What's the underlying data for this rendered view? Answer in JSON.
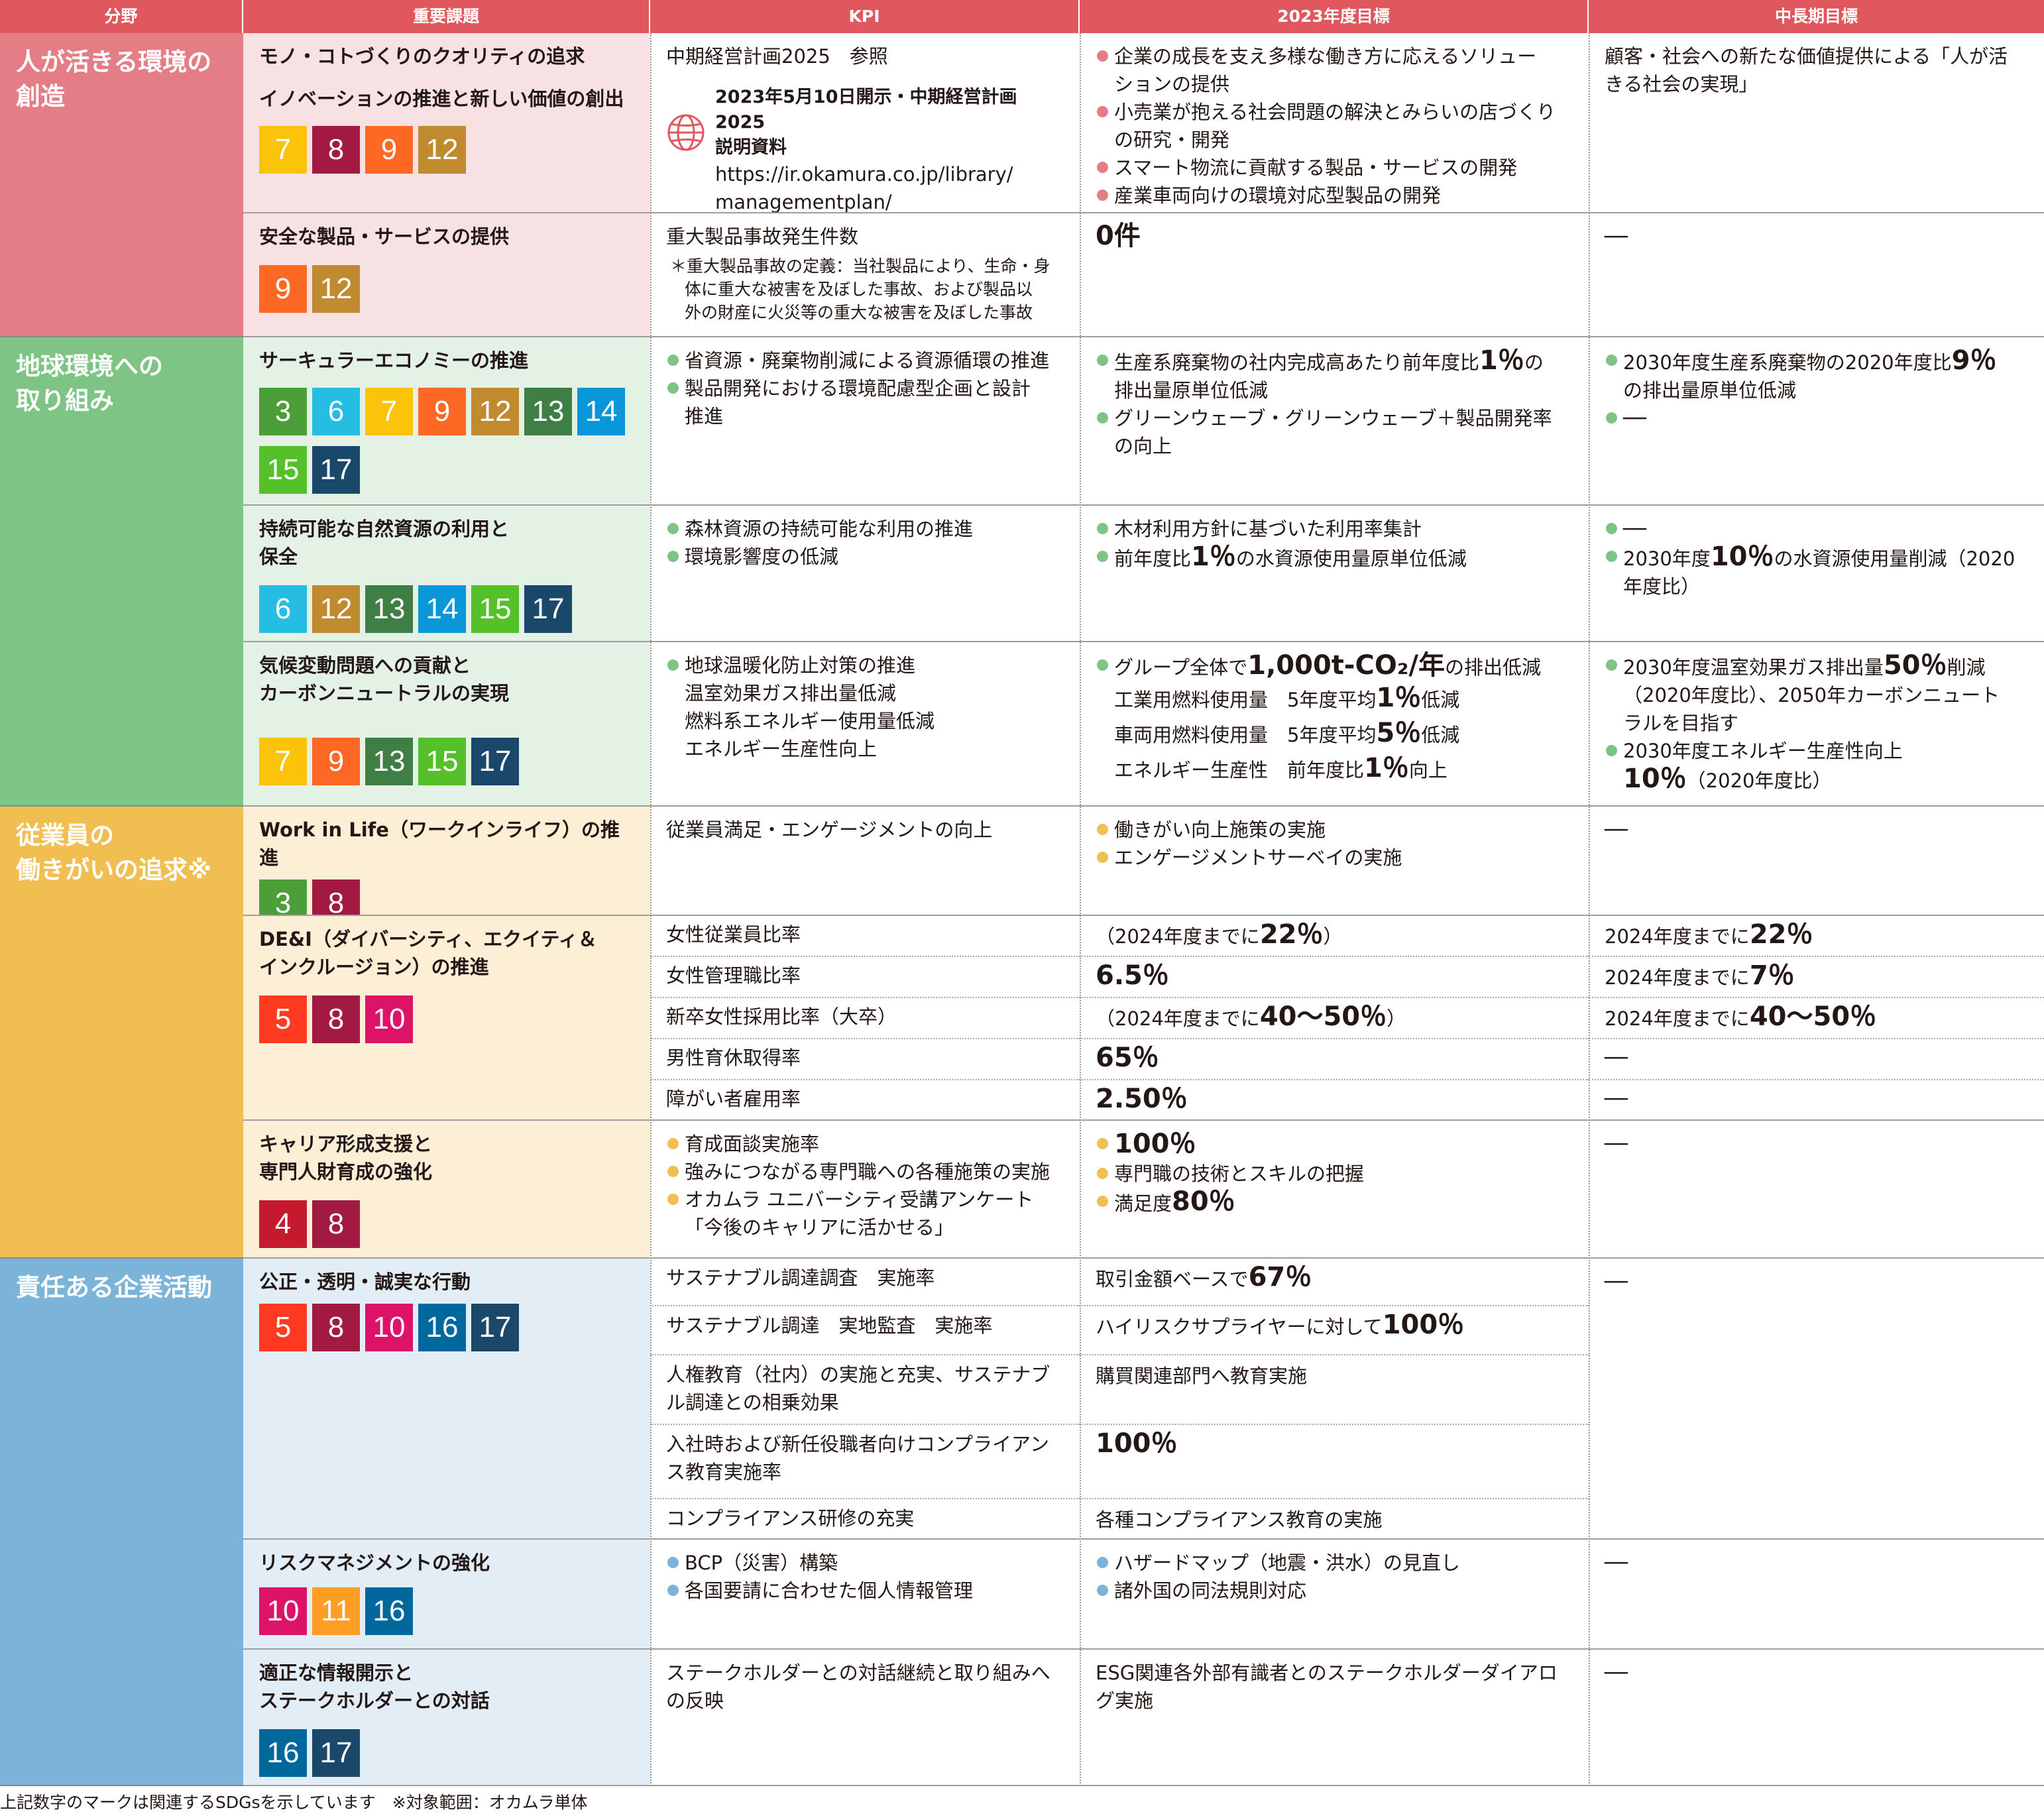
{
  "headers": [
    "分野",
    "重要課題",
    "KPI",
    "2023年度目標",
    "中長期目標"
  ],
  "colors": {
    "pink": "#e57d87",
    "pink_light": "#f7e1e3",
    "green": "#7dc485",
    "green_light": "#e4f2e6",
    "yellow": "#f1be52",
    "yellow_light": "#fcefd6",
    "blue": "#7bb4d8",
    "blue_light": "#e2edf6",
    "header": "#e0585d"
  },
  "sdg_colors": {
    "3": "#4c9f38",
    "4": "#c5192d",
    "5": "#ff3a21",
    "6": "#26bde2",
    "7": "#fcc30b",
    "8": "#a21942",
    "9": "#fd6925",
    "10": "#dd1367",
    "11": "#fd9d24",
    "12": "#bf8b2e",
    "13": "#3f7e44",
    "14": "#0a97d9",
    "15": "#56c02b",
    "16": "#00689d",
    "17": "#19486a"
  },
  "categories": [
    "人が活きる環境の\n創造",
    "地球環境への\n取り組み",
    "従業員の\n働きがいの追求※",
    "責任ある企業活動"
  ],
  "topics": {
    "t1": {
      "title": "モノ・コトづくりのクオリティの追求",
      "title2": "イノベーションの推進と新しい価値の創出",
      "sdgs": [
        "7",
        "8",
        "9",
        "12"
      ]
    },
    "t2": {
      "title": "安全な製品・サービスの提供",
      "sdgs": [
        "9",
        "12"
      ]
    },
    "t3": {
      "title": "サーキュラーエコノミーの推進",
      "sdgs": [
        "3",
        "6",
        "7",
        "9",
        "12",
        "13",
        "14",
        "15",
        "17"
      ]
    },
    "t4": {
      "title": "持続可能な自然資源の利用と\n保全",
      "sdgs": [
        "6",
        "12",
        "13",
        "14",
        "15",
        "17"
      ]
    },
    "t5": {
      "title": "気候変動問題への貢献と\nカーボンニュートラルの実現",
      "sdgs": [
        "7",
        "9",
        "13",
        "15",
        "17"
      ]
    },
    "t6": {
      "title": "Work in Life（ワークインライフ）の推進",
      "sdgs": [
        "3",
        "8"
      ]
    },
    "t7": {
      "title": "DE&I（ダイバーシティ、エクイティ＆\nインクルージョン）の推進",
      "sdgs": [
        "5",
        "8",
        "10"
      ]
    },
    "t8": {
      "title": "キャリア形成支援と\n専門人財育成の強化",
      "sdgs": [
        "4",
        "8"
      ]
    },
    "t9": {
      "title": "公正・透明・誠実な行動",
      "sdgs": [
        "5",
        "8",
        "10",
        "16",
        "17"
      ]
    },
    "t10": {
      "title": "リスクマネジメントの強化",
      "sdgs": [
        "10",
        "11",
        "16"
      ]
    },
    "t11": {
      "title": "適正な情報開示と\nステークホルダーとの対話",
      "sdgs": [
        "16",
        "17"
      ]
    }
  },
  "r1": {
    "kpi": "中期経営計画2025　参照",
    "link_title": "2023年5月10日開示・中期経営計画2025\n説明資料",
    "link_url": "https://ir.okamura.co.jp/library/\nmanagementplan/",
    "target": [
      "企業の成長を支え多様な働き方に応えるソリュー\nションの提供",
      "小売業が抱える社会問題の解決とみらいの店づくり\nの研究・開発",
      "スマート物流に貢献する製品・サービスの開発",
      "産業車両向けの環境対応型製品の開発"
    ],
    "long": "顧客・社会への新たな価値提供による「人が活\nきる社会の実現」"
  },
  "r2": {
    "kpi": "重大製品事故発生件数",
    "note": "＊重大製品事故の定義：当社製品により、生命・身\n体に重大な被害を及ぼした事故、および製品以\n外の財産に火災等の重大な被害を及ぼした事故",
    "target": "0件",
    "long": "──"
  },
  "r3": {
    "kpi": [
      "省資源・廃棄物削減による資源循環の推進",
      "製品開発における環境配慮型企画と設計\n推進"
    ],
    "target1_a": "生産系廃棄物の社内完成高あたり前年度比",
    "target1_b": "1％",
    "target1_c": "の\n排出量原単位低減",
    "target2": "グリーンウェーブ・グリーンウェーブ＋製品開発率\nの向上",
    "long1_a": "2030年度生産系廃棄物の2020年度比",
    "long1_b": "9％",
    "long1_c": "\nの排出量原単位低減",
    "long2": "──"
  },
  "r4": {
    "kpi": [
      "森林資源の持続可能な利用の推進",
      "環境影響度の低減"
    ],
    "target1": "木材利用方針に基づいた利用率集計",
    "target2_a": "前年度比",
    "target2_b": "1％",
    "target2_c": "の水資源使用量原単位低減",
    "long1": "──",
    "long2_a": "2030年度",
    "long2_b": "10％",
    "long2_c": "の水資源使用量削減（2020\n年度比）"
  },
  "r5": {
    "kpi": "地球温暖化防止対策の推進\n温室効果ガス排出量低減\n燃料系エネルギー使用量低減\nエネルギー生産性向上",
    "t_a": "グループ全体で",
    "t_b": "1,000t-CO₂/年",
    "t_c": "の排出低減",
    "t_l1": "工業用燃料使用量　5年度平均",
    "t_l1b": "1％",
    "t_l1c": "低減",
    "t_l2": "車両用燃料使用量　5年度平均",
    "t_l2b": "5％",
    "t_l2c": "低減",
    "t_l3": "エネルギー生産性　前年度比",
    "t_l3b": "1％",
    "t_l3c": "向上",
    "long1_a": "2030年度温室効果ガス排出量",
    "long1_b": "50％",
    "long1_c": "削減\n（2020年度比）、2050年カーボンニュート\nラルを目指す",
    "long2_a": "2030年度エネルギー生産性向上",
    "long2_b": "10％",
    "long2_c": "（2020年度比）"
  },
  "r6": {
    "kpi": "従業員満足・エンゲージメントの向上",
    "target": [
      "働きがい向上施策の実施",
      "エンゲージメントサーベイの実施"
    ],
    "long": "──"
  },
  "r7": {
    "rows": [
      {
        "kpi": "女性従業員比率",
        "t_a": "（2024年度までに",
        "t_b": "22％",
        "t_c": "）",
        "l_a": "2024年度までに",
        "l_b": "22％"
      },
      {
        "kpi": "女性管理職比率",
        "t_a": "",
        "t_b": "6.5％",
        "t_c": "",
        "l_a": "2024年度までに",
        "l_b": "7％"
      },
      {
        "kpi": "新卒女性採用比率（大卒）",
        "t_a": "（2024年度までに",
        "t_b": "40～50％",
        "t_c": "）",
        "l_a": "2024年度までに",
        "l_b": "40～50％"
      },
      {
        "kpi": "男性育休取得率",
        "t_a": "",
        "t_b": "65％",
        "t_c": "",
        "l_a": "",
        "l_b": "──"
      },
      {
        "kpi": "障がい者雇用率",
        "t_a": "",
        "t_b": "2.50％",
        "t_c": "",
        "l_a": "",
        "l_b": "──"
      }
    ]
  },
  "r8": {
    "kpi": [
      "育成面談実施率",
      "強みにつながる専門職への各種施策の実施",
      "オカムラ ユニバーシティ受講アンケート\n「今後のキャリアに活かせる」"
    ],
    "target1": "100％",
    "target2": "専門職の技術とスキルの把握",
    "target3_a": "満足度",
    "target3_b": "80％",
    "long": "──"
  },
  "r9": {
    "rows": [
      {
        "kpi": "サステナブル調達調査　実施率",
        "t_a": "取引金額ベースで",
        "t_b": "67％"
      },
      {
        "kpi": "サステナブル調達　実地監査　実施率",
        "t_a": "ハイリスクサプライヤーに対して",
        "t_b": "100％"
      },
      {
        "kpi": "人権教育（社内）の実施と充実、サステナブ\nル調達との相乗効果",
        "t_a": "購買関連部門へ教育実施",
        "t_b": ""
      },
      {
        "kpi": "入社時および新任役職者向けコンプライアン\nス教育実施率",
        "t_a": "",
        "t_b": "100％"
      },
      {
        "kpi": "コンプライアンス研修の充実",
        "t_a": "各種コンプライアンス教育の実施",
        "t_b": ""
      }
    ],
    "long": "──"
  },
  "r10": {
    "kpi": [
      "BCP（災害）構築",
      "各国要請に合わせた個人情報管理"
    ],
    "target": [
      "ハザードマップ（地震・洪水）の見直し",
      "諸外国の同法規則対応"
    ],
    "long": "──"
  },
  "r11": {
    "kpi": "ステークホルダーとの対話継続と取り組みへ\nの反映",
    "target": "ESG関連各外部有識者とのステークホルダーダイアロ\nグ実施",
    "long": "──"
  },
  "footer": "上記数字のマークは関連するSDGsを示しています　※対象範囲：オカムラ単体"
}
